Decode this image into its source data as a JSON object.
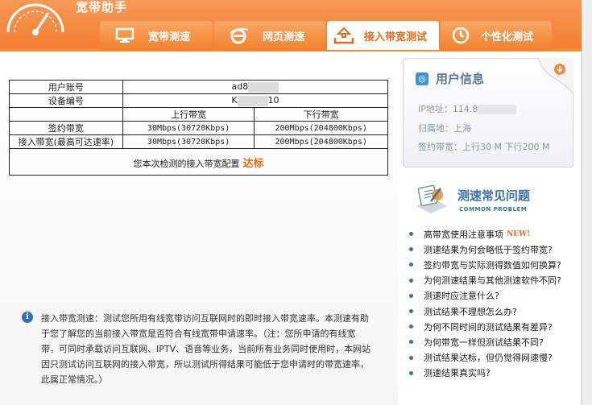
{
  "app": {
    "title": "宽带助手"
  },
  "tabs": [
    {
      "label": "宽带测速",
      "icon": "monitor-icon"
    },
    {
      "label": "网页测速",
      "icon": "ie-browser-icon"
    },
    {
      "label": "接入带宽测试",
      "icon": "upload-tray-icon",
      "active": true
    },
    {
      "label": "个性化测试",
      "icon": "clock-icon"
    }
  ],
  "table": {
    "account_label": "用户账号",
    "account_value_prefix": "ad8",
    "device_label": "设备编号",
    "device_value_prefix": "K",
    "device_value_suffix": "10",
    "upload_header": "上行带宽",
    "download_header": "下行带宽",
    "signed_label": "签约带宽",
    "signed_up": "30Mbps(30720Kbps)",
    "signed_down": "200Mbps(204800Kbps)",
    "access_label": "接入带宽(最高可达速率)",
    "access_up": "30Mbps(30720Kbps)",
    "access_down": "200Mbps(204800Kbps)",
    "result_text": "您本次检测的接入带宽配置",
    "result_status": "达标"
  },
  "note": {
    "icon": "info-icon",
    "text": "接入带宽测速：测试您所用有线宽带访问互联网时的即时接入带宽速率。本测速有助于您了解您的当前接入带宽是否符合有线宽带申请速率。（注：您所申请的有线宽带，可同时承载访问互联网、IPTV、语音等业务，当前所有业务同时使用时，本网站因只测试访问互联网的接入带宽，所以测试所得结果可能低于您申请时的带宽速率，此属正常情况。）"
  },
  "user_info": {
    "title": "用户信息",
    "ip_label": "IP地址：",
    "ip_value_prefix": "114.8",
    "location_label": "归属地：",
    "location_value": "上海",
    "signed_label": "签约带宽：",
    "signed_value": "上行30 M 下行200 M"
  },
  "faq": {
    "title": "测速常见问题",
    "subtitle": "COMMON PROBLEM",
    "new_badge": "NEW!",
    "items": [
      "高带宽使用注意事项",
      "测速结果为何会略低于签约带宽?",
      "签约带宽与实际测得数值如何换算?",
      "为何测速结果与其他测速软件不同?",
      "测速时应注意什么?",
      "测试结果不理想怎么办?",
      "为何不同时间的测试结果有差异?",
      "为何带宽一样但测试结果不同?",
      "测试结果达标，但仍觉得网速慢?",
      "测速结果真实吗?"
    ]
  },
  "colors": {
    "accent": "#f27c2e",
    "status": "#e86c10",
    "link_blue": "#3a70a8"
  }
}
